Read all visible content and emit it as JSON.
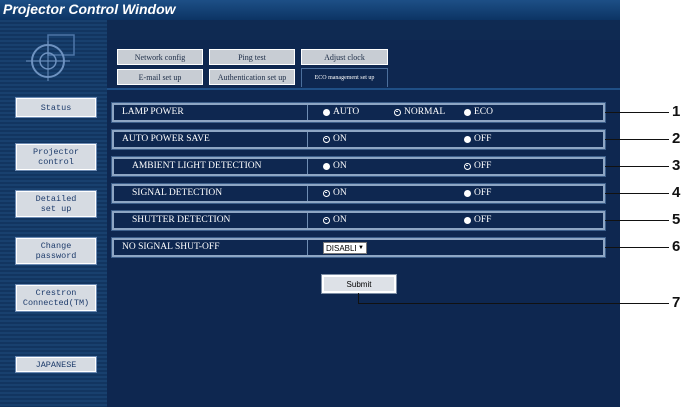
{
  "window": {
    "title": "Projector Control Window"
  },
  "sidebar": {
    "items": [
      {
        "label": "Status"
      },
      {
        "label": "Projector\ncontrol"
      },
      {
        "label": "Detailed\nset up"
      },
      {
        "label": "Change\npassword"
      },
      {
        "label": "Crestron\nConnected(TM)"
      },
      {
        "label": "JAPANESE"
      }
    ]
  },
  "tabs": [
    {
      "label": "Network config"
    },
    {
      "label": "Ping test"
    },
    {
      "label": "Adjust clock"
    },
    {
      "label": "E-mail set up"
    },
    {
      "label": "Authentication set up"
    },
    {
      "label": "ECO management set up"
    }
  ],
  "settings": [
    {
      "label": "LAMP POWER",
      "options": [
        {
          "label": "AUTO",
          "selected": true
        },
        {
          "label": "NORMAL",
          "selected": false
        },
        {
          "label": "ECO",
          "selected": true
        }
      ]
    },
    {
      "label": "AUTO POWER SAVE",
      "options": [
        {
          "label": "ON",
          "selected": false
        },
        {
          "label": "OFF",
          "selected": true
        }
      ]
    },
    {
      "label": "AMBIENT LIGHT DETECTION",
      "options": [
        {
          "label": "ON",
          "selected": true
        },
        {
          "label": "OFF",
          "selected": false
        }
      ]
    },
    {
      "label": "SIGNAL DETECTION",
      "options": [
        {
          "label": "ON",
          "selected": false
        },
        {
          "label": "OFF",
          "selected": true
        }
      ]
    },
    {
      "label": "SHUTTER DETECTION",
      "options": [
        {
          "label": "ON",
          "selected": false
        },
        {
          "label": "OFF",
          "selected": true
        }
      ]
    },
    {
      "label": "NO SIGNAL SHUT-OFF",
      "select_value": "DISABLE"
    }
  ],
  "submit_label": "Submit",
  "callouts": [
    "1",
    "2",
    "3",
    "4",
    "5",
    "6",
    "7"
  ],
  "colors": {
    "titlebar": "#0c3464",
    "panel": "#0e2750",
    "button": "#d6dbe2",
    "text": "#ffffff"
  }
}
